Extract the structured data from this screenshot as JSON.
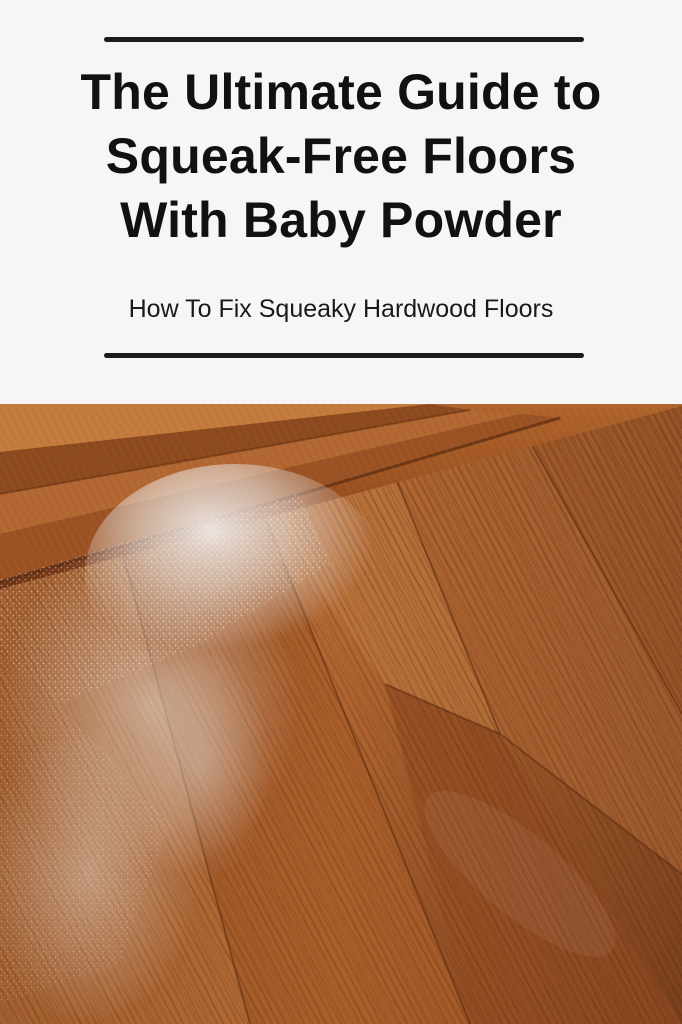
{
  "title": {
    "line1": "The Ultimate Guide to",
    "line2": "Squeak-Free Floors",
    "line3": "With Baby Powder"
  },
  "subtitle": "How To Fix Squeaky Hardwood Floors",
  "photo": {
    "subject": "hardwood floor with baby powder",
    "colors": {
      "wood_light": "#c57a3d",
      "wood_mid": "#a95c28",
      "wood_dark": "#7a3b18",
      "powder": "#e7e0da"
    }
  }
}
